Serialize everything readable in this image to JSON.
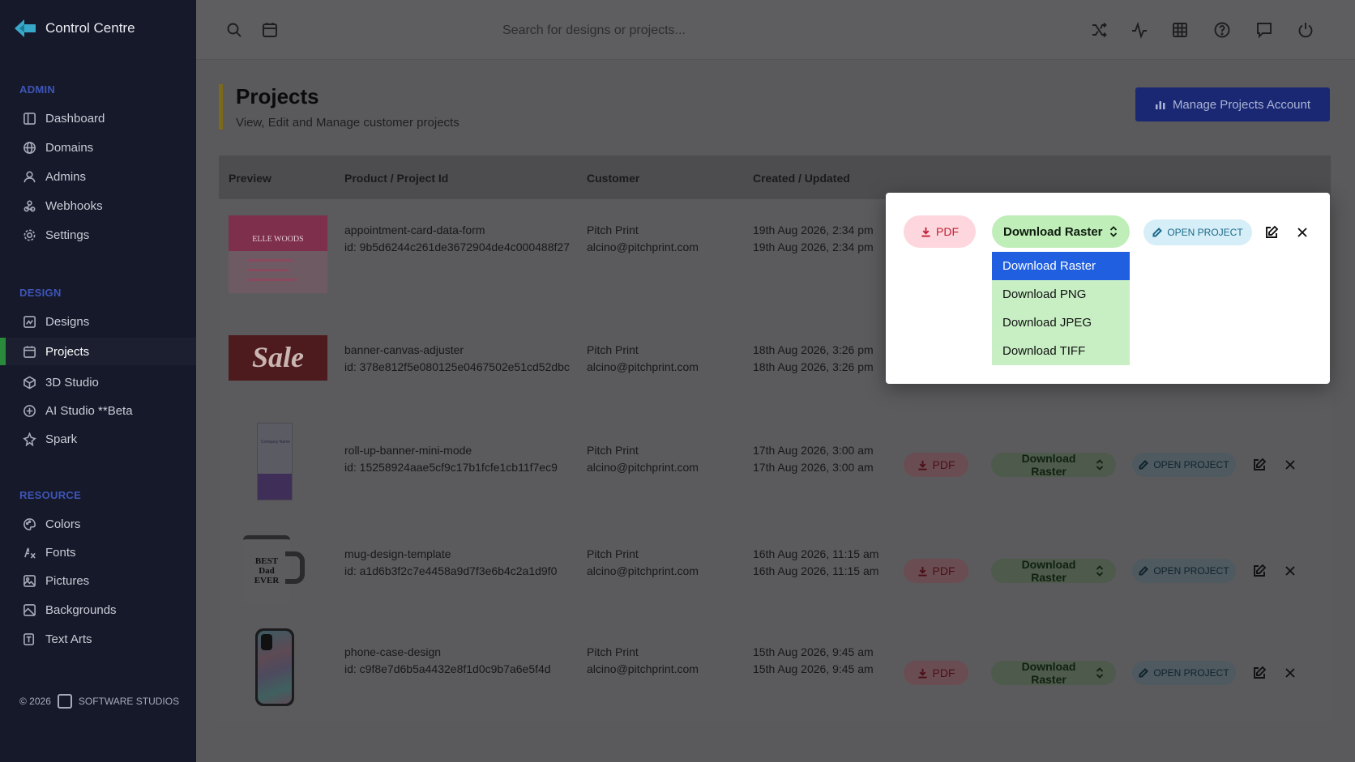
{
  "app": {
    "title": "Control Centre"
  },
  "sidebar": {
    "sections": [
      {
        "label": "ADMIN",
        "items": [
          {
            "label": "Dashboard",
            "icon": "dashboard-icon"
          },
          {
            "label": "Domains",
            "icon": "globe-icon"
          },
          {
            "label": "Admins",
            "icon": "user-icon"
          },
          {
            "label": "Webhooks",
            "icon": "webhook-icon"
          },
          {
            "label": "Settings",
            "icon": "gear-icon"
          }
        ]
      },
      {
        "label": "DESIGN",
        "items": [
          {
            "label": "Designs",
            "icon": "designs-icon"
          },
          {
            "label": "Projects",
            "icon": "calendar-icon",
            "active": true
          },
          {
            "label": "3D Studio",
            "icon": "cube-icon"
          },
          {
            "label": "AI Studio **Beta",
            "icon": "ai-icon"
          },
          {
            "label": "Spark",
            "icon": "spark-icon"
          }
        ]
      },
      {
        "label": "RESOURCE",
        "items": [
          {
            "label": "Colors",
            "icon": "palette-icon"
          },
          {
            "label": "Fonts",
            "icon": "font-icon"
          },
          {
            "label": "Pictures",
            "icon": "image-icon"
          },
          {
            "label": "Backgrounds",
            "icon": "background-icon"
          },
          {
            "label": "Text Arts",
            "icon": "text-art-icon"
          }
        ]
      }
    ],
    "footer": {
      "copyright": "© 2026",
      "company": "SOFTWARE STUDIOS"
    }
  },
  "topbar": {
    "search_placeholder": "Search for designs or projects...",
    "icons": [
      "search-icon",
      "calendar-icon",
      "shuffle-icon",
      "activity-icon",
      "grid-icon",
      "help-icon",
      "chat-icon",
      "power-icon"
    ]
  },
  "page": {
    "title": "Projects",
    "subtitle": "View, Edit and Manage customer projects",
    "manage_button": "Manage Projects Account"
  },
  "table": {
    "headers": [
      "Preview",
      "Product / Project Id",
      "Customer",
      "Created / Updated"
    ],
    "rows": [
      {
        "name": "appointment-card-data-form",
        "id": "id: 9b5d6244c261de3672904de4c000488f27",
        "customer": "Pitch Print",
        "email": "alcino@pitchprint.com",
        "created": "19th Aug 2026, 2:34 pm",
        "updated": "19th Aug 2026, 2:34 pm",
        "thumb_text": "ELLE WOODS"
      },
      {
        "name": "banner-canvas-adjuster",
        "id": "id: 378e812f5e080125e0467502e51cd52dbc",
        "customer": "Pitch Print",
        "email": "alcino@pitchprint.com",
        "created": "18th Aug 2026, 3:26 pm",
        "updated": "18th Aug 2026, 3:26 pm",
        "thumb_text": "Sale"
      },
      {
        "name": "roll-up-banner-mini-mode",
        "id": "id: 15258924aae5cf9c17b1fcfe1cb11f7ec9",
        "customer": "Pitch Print",
        "email": "alcino@pitchprint.com",
        "created": "17th Aug 2026, 3:00 am",
        "updated": "17th Aug 2026, 3:00 am",
        "thumb_text": "Company Name"
      },
      {
        "name": "mug-design-template",
        "id": "id: a1d6b3f2c7e4458a9d7f3e6b4c2a1d9f0",
        "customer": "Pitch Print",
        "email": "alcino@pitchprint.com",
        "created": "16th Aug 2026, 11:15 am",
        "updated": "16th Aug 2026, 11:15 am",
        "thumb_text": "BEST Dad EVER"
      },
      {
        "name": "phone-case-design",
        "id": "id: c9f8e7d6b5a4432e8f1d0c9b7a6e5f4d",
        "customer": "Pitch Print",
        "email": "alcino@pitchprint.com",
        "created": "15th Aug 2026, 9:45 am",
        "updated": "15th Aug 2026, 9:45 am",
        "thumb_text": ""
      }
    ]
  },
  "actions": {
    "pdf_label": "PDF",
    "raster_label": "Download Raster",
    "open_label": "OPEN PROJECT"
  },
  "popup": {
    "dropdown_options": [
      "Download Raster",
      "Download PNG",
      "Download JPEG",
      "Download TIFF"
    ],
    "selected": "Download Raster"
  },
  "colors": {
    "sidebar_bg": "#15192a",
    "accent_blue": "#1f5fe0",
    "active_marker": "#2a8a3c",
    "pdf_pink": "#fdd7dd",
    "raster_green": "#bfeeb9"
  }
}
